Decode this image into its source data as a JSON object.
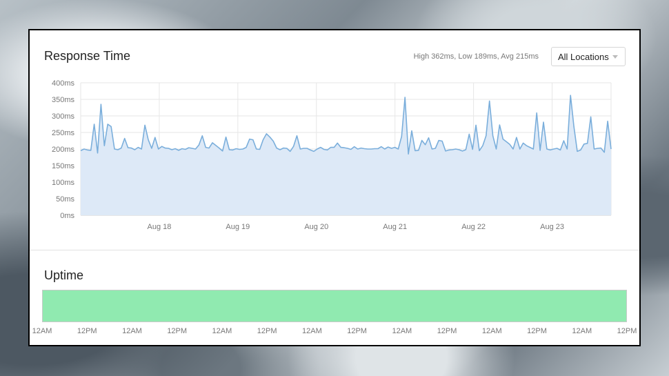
{
  "panel": {
    "response_title": "Response Time",
    "stats": "High 362ms, Low 189ms, Avg 215ms",
    "location_select": "All Locations",
    "uptime_title": "Uptime"
  },
  "colors": {
    "line": "#7aaedb",
    "fill": "#dde9f7",
    "uptime": "#90eab0",
    "grid": "#e6e6e6"
  },
  "chart_data": [
    {
      "type": "area",
      "title": "Response Time",
      "ylabel": "",
      "xlabel": "",
      "ylim": [
        0,
        400
      ],
      "xlim": [
        0,
        162
      ],
      "y_ticks": [
        "0ms",
        "50ms",
        "100ms",
        "150ms",
        "200ms",
        "250ms",
        "300ms",
        "350ms",
        "400ms"
      ],
      "x_ticks": [
        {
          "label": "Aug 18",
          "x": 24
        },
        {
          "label": "Aug 19",
          "x": 48
        },
        {
          "label": "Aug 20",
          "x": 72
        },
        {
          "label": "Aug 21",
          "x": 96
        },
        {
          "label": "Aug 22",
          "x": 120
        },
        {
          "label": "Aug 23",
          "x": 144
        }
      ],
      "x_unit": "hours from start",
      "grid": true,
      "series": [
        {
          "values": [
            195,
            200,
            197,
            196,
            275,
            188,
            335,
            210,
            275,
            268,
            200,
            198,
            203,
            232,
            204,
            203,
            198,
            205,
            200,
            272,
            228,
            202,
            235,
            200,
            208,
            203,
            202,
            198,
            201,
            196,
            201,
            199,
            204,
            202,
            200,
            212,
            240,
            205,
            203,
            219,
            211,
            203,
            194,
            236,
            198,
            197,
            201,
            199,
            200,
            205,
            230,
            228,
            200,
            199,
            228,
            246,
            236,
            224,
            203,
            198,
            203,
            202,
            193,
            208,
            240,
            200,
            202,
            202,
            197,
            193,
            200,
            205,
            199,
            197,
            205,
            205,
            218,
            205,
            204,
            202,
            199,
            207,
            200,
            203,
            201,
            200,
            200,
            201,
            201,
            207,
            200,
            206,
            202,
            205,
            200,
            238,
            356,
            185,
            255,
            195,
            196,
            226,
            213,
            234,
            200,
            202,
            226,
            224,
            194,
            197,
            198,
            200,
            198,
            194,
            198,
            245,
            199,
            272,
            195,
            210,
            240,
            345,
            240,
            200,
            273,
            230,
            222,
            214,
            200,
            235,
            200,
            218,
            210,
            205,
            200,
            309,
            196,
            281,
            200,
            197,
            200,
            202,
            197,
            225,
            200,
            362,
            268,
            193,
            197,
            215,
            217,
            297,
            200,
            202,
            203,
            190,
            284,
            200
          ]
        }
      ]
    },
    {
      "type": "bar",
      "title": "Uptime",
      "x_ticks": [
        "12AM",
        "12PM",
        "12AM",
        "12PM",
        "12AM",
        "12PM",
        "12AM",
        "12PM",
        "12AM",
        "12PM",
        "12AM",
        "12PM",
        "12AM",
        "12PM"
      ],
      "values": [
        100
      ]
    }
  ]
}
